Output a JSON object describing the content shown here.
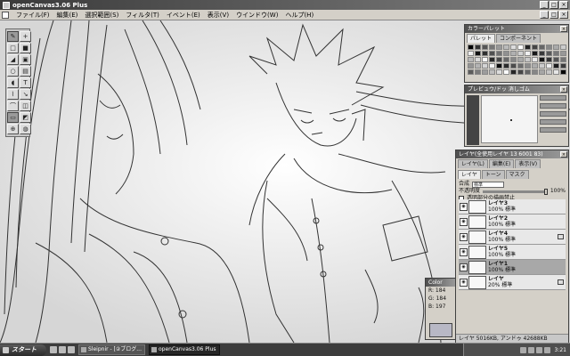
{
  "window": {
    "title": "openCanvas3.06 Plus"
  },
  "window_buttons": [
    "_",
    "□",
    "×"
  ],
  "menu": [
    "ファイル(F)",
    "編集(E)",
    "選択範囲(S)",
    "フィルタ(T)",
    "イベント(E)",
    "表示(V)",
    "ウインドウ(W)",
    "ヘルプ(H)"
  ],
  "tools": [
    "✎",
    "+",
    "□",
    "■",
    "◢",
    "▣",
    "○",
    "▤",
    "◖",
    "T",
    "⌇",
    "↘",
    "⌒",
    "◫",
    "▭",
    "◩",
    "⊕",
    "◍"
  ],
  "palette": {
    "title": "カラーパレット",
    "tabs": [
      "パレット",
      "コンポーネント"
    ],
    "swatches": [
      "#000000",
      "#333333",
      "#555555",
      "#777777",
      "#999999",
      "#bbbbbb",
      "#dddddd",
      "#ffffff",
      "#222222",
      "#444444",
      "#666666",
      "#888888",
      "#aaaaaa",
      "#cccccc",
      "#eeeeee",
      "#101010",
      "#303030",
      "#505050",
      "#707070",
      "#909090",
      "#b0b0b0",
      "#d0d0d0",
      "#f0f0f0",
      "#181818",
      "#383838",
      "#585858",
      "#787878",
      "#989898",
      "#b8b8b8",
      "#d8d8d8",
      "#f8f8f8",
      "#282828",
      "#484848",
      "#686868",
      "#888888",
      "#a8a8a8",
      "#c8c8c8",
      "#e8e8e8",
      "#141414",
      "#343434",
      "#545454",
      "#747474",
      "#949494",
      "#b4b4b4",
      "#d4d4d4",
      "#f4f4f4",
      "#0c0c0c",
      "#2c2c2c",
      "#4c4c4c",
      "#6c6c6c",
      "#8c8c8c",
      "#acacac",
      "#cccccc",
      "#ececec",
      "#1c1c1c",
      "#3c3c3c",
      "#5c5c5c",
      "#7c7c7c",
      "#9c9c9c",
      "#bcbcbc",
      "#dcdcdc",
      "#fcfcfc",
      "#262626",
      "#464646",
      "#666666",
      "#868686",
      "#a6a6a6",
      "#c6c6c6",
      "#e6e6e6",
      "#060606"
    ]
  },
  "preview": {
    "title": "プレビュウ/ドッ 消しゴム",
    "tabs": [
      "スポイト",
      "消しゴム"
    ]
  },
  "layers": {
    "title": "レイヤ(全使用レイヤ 13 6001 83)",
    "tabs": [
      "レイヤ",
      "トーン",
      "マスク"
    ],
    "submenu": [
      "レイヤ(L)",
      "編集(E)",
      "表示(V)"
    ],
    "mode_label": "合成",
    "mode_value": "標準",
    "opacity_label": "不透明度",
    "opacity_value": "100%",
    "opacity_fraction": 1.0,
    "protect_label": "透明部分の描画禁止",
    "items": [
      {
        "name": "レイヤ3",
        "info": "100% 標準",
        "selected": false,
        "flag": false
      },
      {
        "name": "レイヤ2",
        "info": "100% 標準",
        "selected": false,
        "flag": false
      },
      {
        "name": "レイヤ4",
        "info": "100% 標準",
        "selected": false,
        "flag": true
      },
      {
        "name": "レイヤ5",
        "info": "100% 標準",
        "selected": false,
        "flag": false
      },
      {
        "name": "レイヤ1",
        "info": "100% 標準",
        "selected": true,
        "flag": false
      },
      {
        "name": "レイヤ",
        "info": "20% 標準",
        "selected": false,
        "flag": true
      }
    ],
    "status": "レイヤ 5016KB, アンドゥ 42688KB"
  },
  "color": {
    "title": "Color",
    "r": "R: 184",
    "g": "G: 184",
    "b": "B: 197",
    "swatch": "#b8b8c5"
  },
  "taskbar": {
    "start": "スタート",
    "tasks": [
      {
        "label": "Sleipnir - [②ブログ...",
        "active": false
      },
      {
        "label": "openCanvas3.06 Plus",
        "active": true
      }
    ],
    "clock": "3:21"
  }
}
